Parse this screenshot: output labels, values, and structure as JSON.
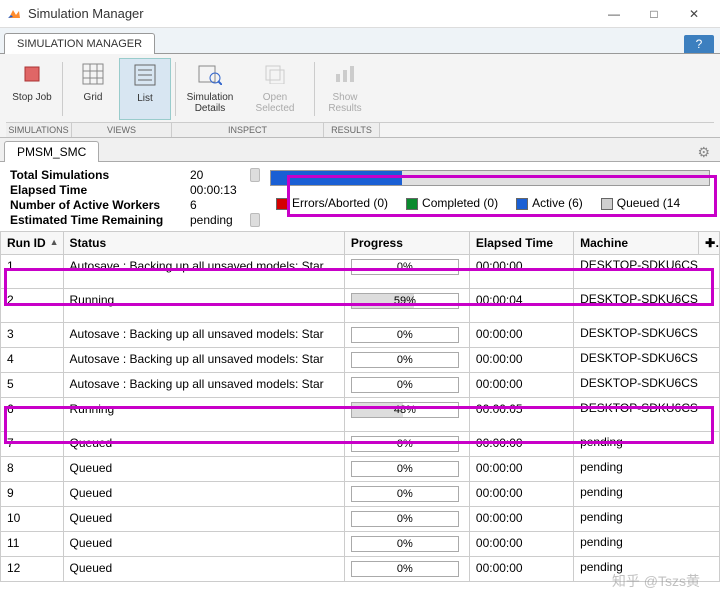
{
  "window": {
    "title": "Simulation Manager"
  },
  "ribbon": {
    "tab": "SIMULATION MANAGER",
    "stop": "Stop Job",
    "grid": "Grid",
    "list": "List",
    "details": "Simulation\nDetails",
    "open": "Open Selected",
    "results": "Show\nResults",
    "group_sim": "SIMULATIONS",
    "group_views": "VIEWS",
    "group_inspect": "INSPECT",
    "group_results": "RESULTS"
  },
  "tab": {
    "name": "PMSM_SMC"
  },
  "summary": {
    "total_label": "Total Simulations",
    "total_val": "20",
    "elapsed_label": "Elapsed Time",
    "elapsed_val": "00:00:13",
    "workers_label": "Number of Active Workers",
    "workers_val": "6",
    "remain_label": "Estimated Time Remaining",
    "remain_val": "pending",
    "overall_pct": 30
  },
  "legend": {
    "errors": {
      "label": "Errors/Aborted (0)",
      "color": "#d40000"
    },
    "completed": {
      "label": "Completed (0)",
      "color": "#0a8a2e"
    },
    "active": {
      "label": "Active (6)",
      "color": "#1a5fd4"
    },
    "queued": {
      "label": "Queued (14",
      "color": "#cfcfcf"
    }
  },
  "columns": {
    "run": "Run ID",
    "status": "Status",
    "progress": "Progress",
    "elapsed": "Elapsed Time",
    "machine": "Machine"
  },
  "rows": [
    {
      "id": "1",
      "status": "Autosave : Backing up all unsaved models: Star",
      "pct": 0,
      "elapsed": "00:00:00",
      "machine": "DESKTOP-SDKU6CS"
    },
    {
      "id": "2",
      "status": "Running",
      "pct": 59,
      "elapsed": "00:00:04",
      "machine": "DESKTOP-SDKU6CS"
    },
    {
      "id": "3",
      "status": "Autosave : Backing up all unsaved models: Star",
      "pct": 0,
      "elapsed": "00:00:00",
      "machine": "DESKTOP-SDKU6CS"
    },
    {
      "id": "4",
      "status": "Autosave : Backing up all unsaved models: Star",
      "pct": 0,
      "elapsed": "00:00:00",
      "machine": "DESKTOP-SDKU6CS"
    },
    {
      "id": "5",
      "status": "Autosave : Backing up all unsaved models: Star",
      "pct": 0,
      "elapsed": "00:00:00",
      "machine": "DESKTOP-SDKU6CS"
    },
    {
      "id": "6",
      "status": "Running",
      "pct": 48,
      "elapsed": "00:00:05",
      "machine": "DESKTOP-SDKU6CS"
    },
    {
      "id": "7",
      "status": "Queued",
      "pct": 0,
      "elapsed": "00:00:00",
      "machine": "pending"
    },
    {
      "id": "8",
      "status": "Queued",
      "pct": 0,
      "elapsed": "00:00:00",
      "machine": "pending"
    },
    {
      "id": "9",
      "status": "Queued",
      "pct": 0,
      "elapsed": "00:00:00",
      "machine": "pending"
    },
    {
      "id": "10",
      "status": "Queued",
      "pct": 0,
      "elapsed": "00:00:00",
      "machine": "pending"
    },
    {
      "id": "11",
      "status": "Queued",
      "pct": 0,
      "elapsed": "00:00:00",
      "machine": "pending"
    },
    {
      "id": "12",
      "status": "Queued",
      "pct": 0,
      "elapsed": "00:00:00",
      "machine": "pending"
    }
  ],
  "watermark": "知乎 @Tszs黄"
}
